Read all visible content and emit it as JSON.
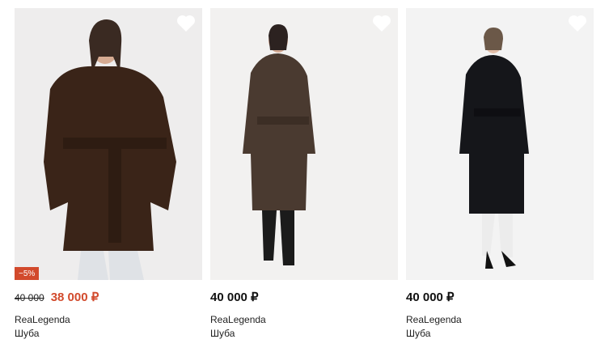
{
  "products": [
    {
      "badge": "−5%",
      "old_price": "40 000",
      "price": "38 000 ₽",
      "brand": "ReaLegenda",
      "type": "Шуба",
      "coat_color": "#3a2418"
    },
    {
      "price": "40 000 ₽",
      "brand": "ReaLegenda",
      "type": "Шуба",
      "coat_color": "#4a3a30"
    },
    {
      "price": "40 000 ₽",
      "brand": "ReaLegenda",
      "type": "Шуба",
      "coat_color": "#15161a"
    }
  ],
  "colors": {
    "sale": "#d24a2c",
    "photo_bg": "#efefef"
  }
}
